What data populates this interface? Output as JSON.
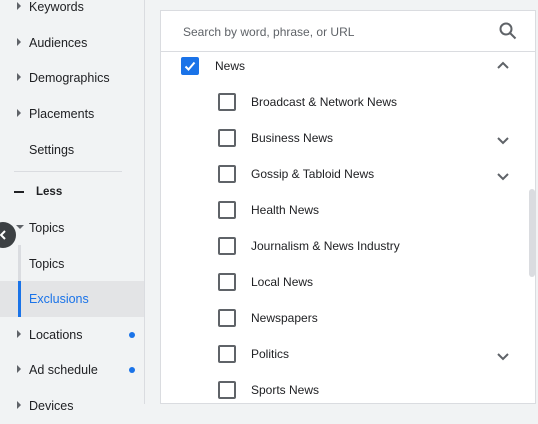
{
  "sidebar": {
    "items": [
      {
        "label": "Keywords"
      },
      {
        "label": "Audiences"
      },
      {
        "label": "Demographics"
      },
      {
        "label": "Placements"
      },
      {
        "label": "Settings"
      }
    ],
    "less_label": "Less",
    "topics_label": "Topics",
    "sub_items": [
      {
        "label": "Topics"
      },
      {
        "label": "Exclusions"
      }
    ],
    "locations_label": "Locations",
    "ad_schedule_label": "Ad schedule",
    "devices_label": "Devices",
    "accent_color": "#1a73e8"
  },
  "search": {
    "placeholder": "Search by word, phrase, or URL"
  },
  "topic_list": {
    "parent": {
      "label": "News",
      "checked": true,
      "expanded": true
    },
    "children": [
      {
        "label": "Broadcast & Network News",
        "checked": false,
        "has_children": false
      },
      {
        "label": "Business News",
        "checked": false,
        "has_children": true
      },
      {
        "label": "Gossip & Tabloid News",
        "checked": false,
        "has_children": true
      },
      {
        "label": "Health News",
        "checked": false,
        "has_children": false
      },
      {
        "label": "Journalism & News Industry",
        "checked": false,
        "has_children": false
      },
      {
        "label": "Local News",
        "checked": false,
        "has_children": false
      },
      {
        "label": "Newspapers",
        "checked": false,
        "has_children": false
      },
      {
        "label": "Politics",
        "checked": false,
        "has_children": true
      },
      {
        "label": "Sports News",
        "checked": false,
        "has_children": false
      }
    ]
  }
}
